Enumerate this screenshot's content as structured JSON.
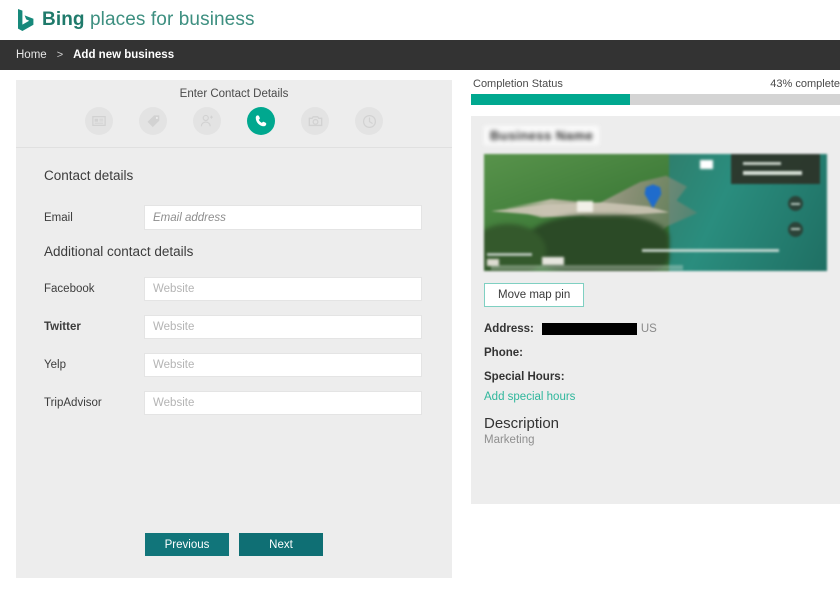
{
  "brand": {
    "logo_icon": "bing-b-logo-icon",
    "name_strong": "Bing",
    "name_light": " places for business",
    "color": "#2e8b7a"
  },
  "breadcrumb": {
    "home": "Home",
    "separator": ">",
    "current": "Add new business"
  },
  "left_panel": {
    "step_title": "Enter Contact Details",
    "steps": [
      {
        "icon": "business-card-icon",
        "active": false
      },
      {
        "icon": "tag-icon",
        "active": false
      },
      {
        "icon": "person-icon",
        "active": false
      },
      {
        "icon": "phone-icon",
        "active": true
      },
      {
        "icon": "camera-icon",
        "active": false
      },
      {
        "icon": "clock-icon",
        "active": false
      }
    ],
    "section_contact": "Contact details",
    "section_additional": "Additional contact details",
    "email": {
      "label": "Email",
      "placeholder": "Email address",
      "value": ""
    },
    "social": [
      {
        "label": "Facebook",
        "placeholder": "Website",
        "value": ""
      },
      {
        "label": "Twitter",
        "placeholder": "Website",
        "value": ""
      },
      {
        "label": "Yelp",
        "placeholder": "Website",
        "value": ""
      },
      {
        "label": "TripAdvisor",
        "placeholder": "Website",
        "value": ""
      }
    ],
    "previous_label": "Previous",
    "next_label": "Next"
  },
  "right_panel": {
    "completion_label": "Completion Status",
    "completion_text": "43% complete",
    "completion_percent": 43,
    "progress_color": "#00a88f",
    "business_name_redacted": "Business Name",
    "map": {
      "pin_icon": "map-pin-icon",
      "zoom_in_icon": "map-zoom-in-icon",
      "zoom_out_icon": "map-zoom-out-icon"
    },
    "move_pin_label": "Move map pin",
    "address_label": "Address:",
    "address_value_redacted": "",
    "address_country": "US",
    "phone_label": "Phone:",
    "phone_value": "",
    "special_hours_label": "Special Hours:",
    "add_special_hours_label": "Add special hours",
    "description_heading": "Description",
    "description_body": "Marketing"
  }
}
